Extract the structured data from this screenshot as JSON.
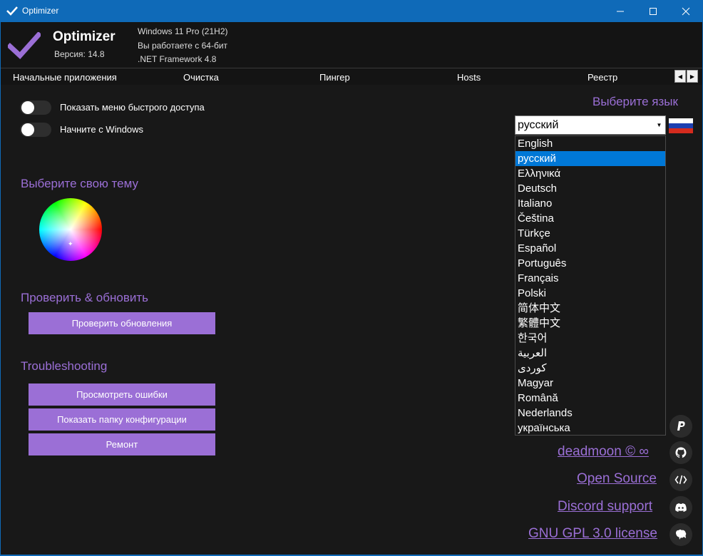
{
  "window": {
    "title": "Optimizer",
    "controls": [
      "minimize-icon",
      "maximize-icon",
      "close-icon"
    ]
  },
  "header": {
    "app_name": "Optimizer",
    "version": "Версия: 14.8",
    "os": "Windows 11 Pro (21H2)",
    "arch": "Вы работаете с 64-бит",
    "framework": ".NET Framework 4.8"
  },
  "tabs": [
    "Начальные приложения",
    "Очистка",
    "Пингер",
    "Hosts",
    "Реестр"
  ],
  "options": {
    "quick_access_label": "Показать меню быстрого доступа",
    "startup_label": "Начните с Windows"
  },
  "theme": {
    "title": "Выберите свою тему"
  },
  "update": {
    "title": "Проверить & обновить",
    "check_button": "Проверить обновления"
  },
  "troubleshooting": {
    "title": "Troubleshooting",
    "view_errors_button": "Просмотреть ошибки",
    "show_config_button": "Показать папку конфигурации",
    "repair_button": "Ремонт"
  },
  "language": {
    "title": "Выберите язык",
    "selected": "русский",
    "options": [
      "English",
      "русский",
      "Ελληνικά",
      "Deutsch",
      "Italiano",
      "Čeština",
      "Türkçe",
      "Español",
      "Português",
      "Français",
      "Polski",
      "简体中文",
      "繁體中文",
      "한국어",
      "العربية",
      "كوردی",
      "Magyar",
      "Română",
      "Nederlands",
      "українська"
    ]
  },
  "links": {
    "author": "deadmoon © ∞",
    "source": "Open Source",
    "discord": "Discord support",
    "license": "GNU GPL 3.0 license"
  },
  "social_icons": [
    "paypal-icon",
    "github-icon",
    "code-icon",
    "discord-icon",
    "gnu-icon"
  ],
  "colors": {
    "accent": "#9b6fd6",
    "titlebar": "#0f6ab8",
    "background": "#181818",
    "selection": "#0078d7"
  }
}
